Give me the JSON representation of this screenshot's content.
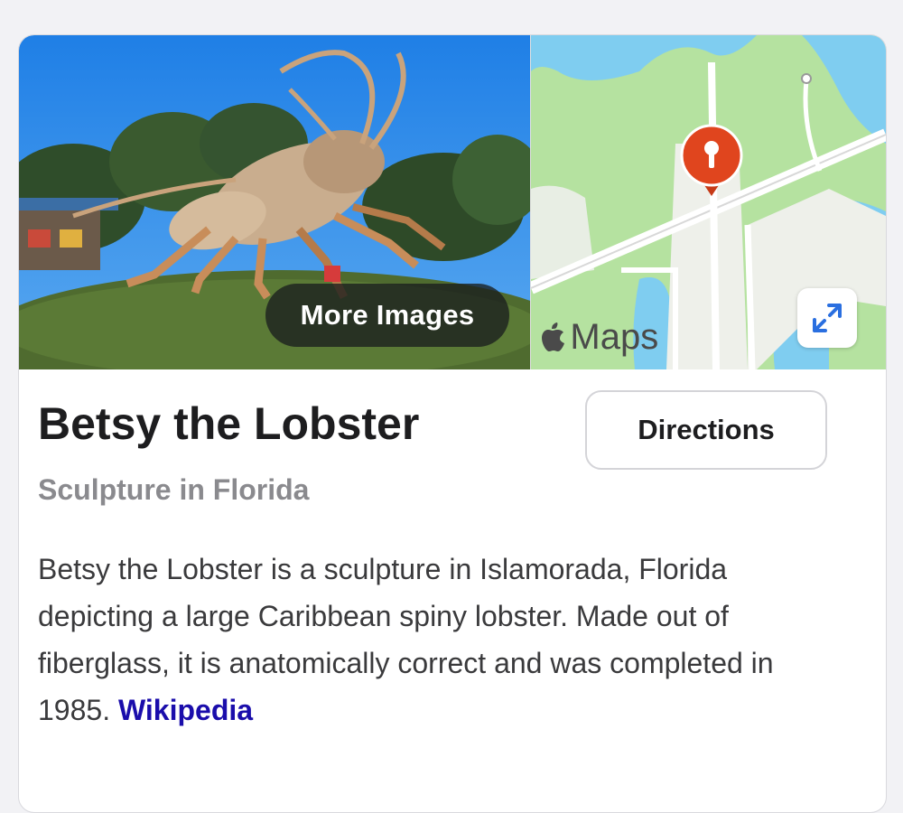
{
  "media": {
    "more_images_label": "More Images",
    "maps_label": "Maps"
  },
  "place": {
    "title": "Betsy the Lobster",
    "subtitle": "Sculpture in Florida",
    "directions_label": "Directions",
    "description": "Betsy the Lobster is a sculpture in Islamorada, Florida depicting a large Caribbean spiny lobster. Made out of fiberglass, it is anatomically correct and was completed in 1985.",
    "source_link": "Wikipedia"
  },
  "colors": {
    "link": "#1a0dab",
    "pin": "#e0451e",
    "map_green": "#b5e2a0",
    "map_water": "#7fcdf0"
  },
  "icons": {
    "map_pin": "map-pin-icon",
    "expand": "expand-icon",
    "apple": "apple-logo-icon"
  }
}
